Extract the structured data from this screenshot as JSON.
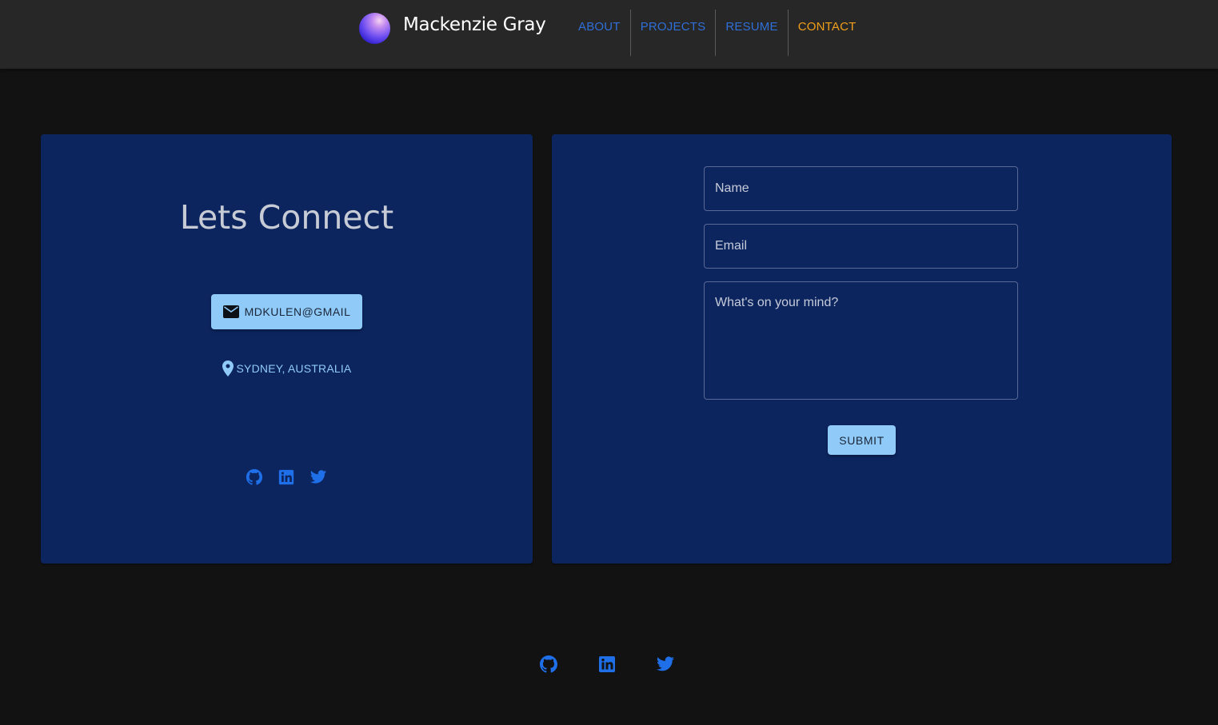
{
  "header": {
    "brand": "Mackenzie Gray",
    "nav": [
      {
        "label": "ABOUT",
        "active": false
      },
      {
        "label": "PROJECTS",
        "active": false
      },
      {
        "label": "RESUME",
        "active": false
      },
      {
        "label": "CONTACT",
        "active": true
      }
    ]
  },
  "contact_card": {
    "title": "Lets Connect",
    "email_button": "MDKULEN@GMAIL",
    "location": "SYDNEY, AUSTRALIA",
    "socials": [
      "github-icon",
      "linkedin-icon",
      "twitter-icon"
    ]
  },
  "form": {
    "name_placeholder": "Name",
    "email_placeholder": "Email",
    "message_placeholder": "What's on your mind?",
    "submit_label": "SUBMIT"
  },
  "footer": {
    "socials": [
      "github-icon",
      "linkedin-icon",
      "twitter-icon"
    ]
  },
  "colors": {
    "background": "#121212",
    "header": "#272727",
    "card": "#0c255e",
    "nav_link": "#2f6fd8",
    "nav_active": "#f29f1a",
    "button": "#90caf9",
    "icon": "#1e6fe8"
  }
}
